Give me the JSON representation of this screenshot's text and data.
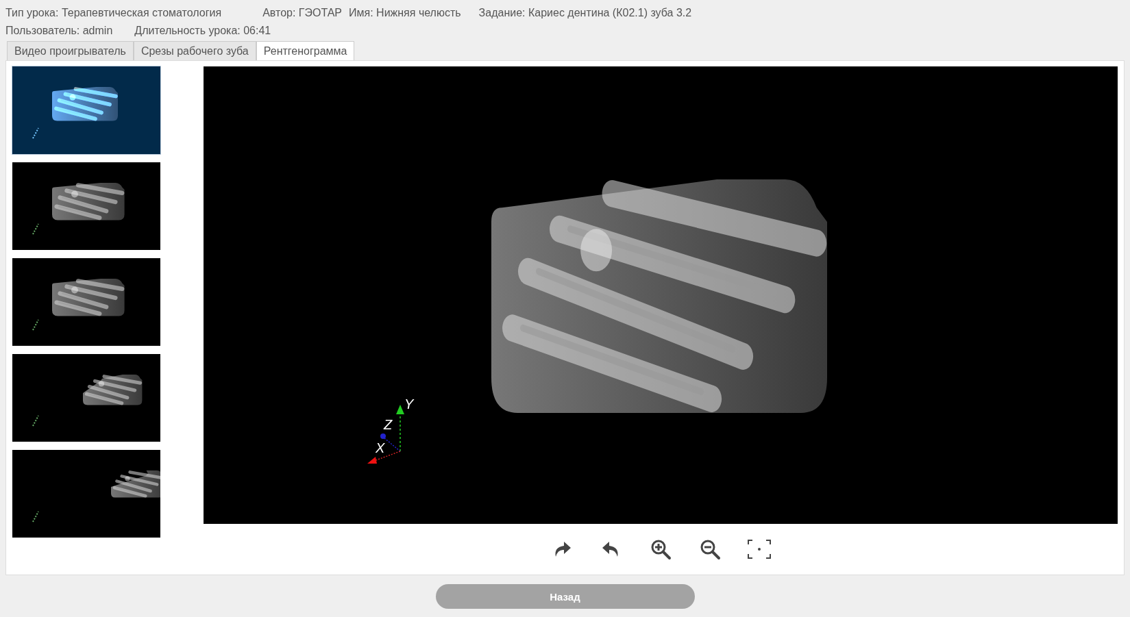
{
  "header": {
    "line1": [
      {
        "label": "Тип урока: Терапевтическая стоматология"
      },
      {
        "label": "Автор: ГЭОТАР"
      },
      {
        "label": "Имя: Нижняя челюсть"
      },
      {
        "label": "Задание: Кариес дентина (К02.1) зуба 3.2"
      }
    ],
    "line2": [
      {
        "label": "Пользователь: admin"
      },
      {
        "label": "Длительность урока: 06:41"
      }
    ]
  },
  "tabs": [
    {
      "label": "Видео проигрыватель",
      "selected": false
    },
    {
      "label": "Срезы рабочего зуба",
      "selected": false
    },
    {
      "label": "Рентгенограмма",
      "selected": true
    }
  ],
  "thumbnails": [
    {
      "selected": true
    },
    {
      "selected": false
    },
    {
      "selected": false
    },
    {
      "selected": false
    },
    {
      "selected": false
    }
  ],
  "viewer": {
    "axes": [
      {
        "label": "Y"
      },
      {
        "label": "Z"
      },
      {
        "label": "X"
      }
    ]
  },
  "back_button": {
    "label": "Назад"
  }
}
